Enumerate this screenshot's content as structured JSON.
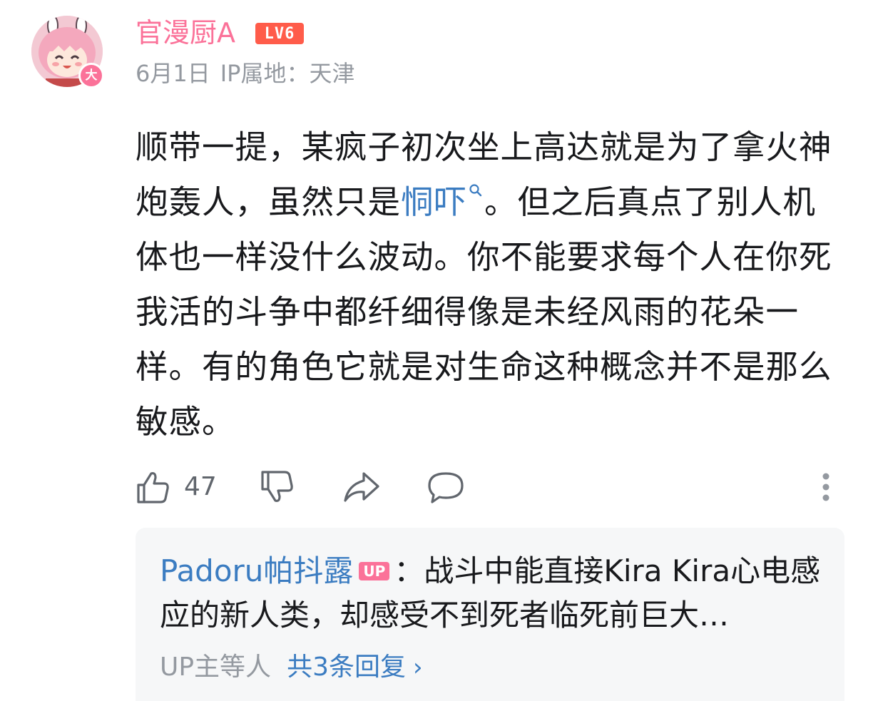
{
  "comment": {
    "avatar": {
      "badge": "大"
    },
    "username": "官漫厨A",
    "level": "LV6",
    "date": "6月1日",
    "ip_location": "IP属地：天津",
    "content": {
      "before_link": "顺带一提，某疯子初次坐上高达就是为了拿火神炮轰人，虽然只是",
      "link": "恫吓",
      "after_link": "。但之后真点了别人机体也一样没什么波动。你不能要求每个人在你死我活的斗争中都纤细得像是未经风雨的花朵一样。有的角色它就是对生命这种概念并不是那么敏感。"
    },
    "actions": {
      "like_count": "47"
    }
  },
  "replies": {
    "reply_user": "Padoru帕抖露",
    "up_badge": "UP",
    "reply_text": "：战斗中能直接Kira Kira心电感应的新人类，却感受不到死者临死前巨大…",
    "replied_by": "UP主等人",
    "total": "共3条回复"
  },
  "colors": {
    "username": "#fb7299",
    "level_badge": "#ff5c4a",
    "link": "#3b7cc1",
    "meta": "#9499a0",
    "text": "#18191c",
    "reply_bg": "#f6f7f8"
  },
  "icons": [
    "thumb-up-icon",
    "thumb-down-icon",
    "share-icon",
    "comment-icon",
    "more-vertical-icon",
    "search-icon"
  ]
}
